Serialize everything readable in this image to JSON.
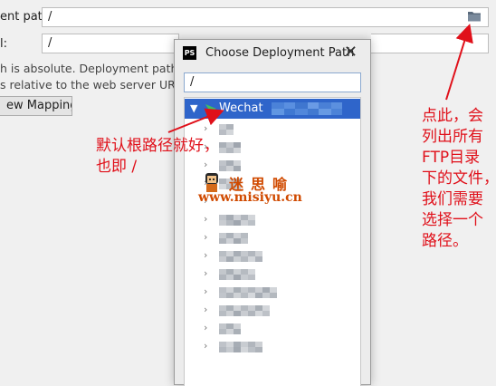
{
  "background_form": {
    "deployment_path_label": "ent path:",
    "deployment_path_value": "/",
    "second_label": "l:",
    "second_value": "/",
    "note_line1": "h is absolute. Deployment path is re",
    "note_line2": "s relative to the web server URL (",
    "mapping_button": "ew Mapping"
  },
  "dialog": {
    "title": "Choose Deployment Path",
    "app_icon_text": "PS",
    "path_value": "/",
    "tree": {
      "root_label": "Wechat",
      "child_count": 12
    }
  },
  "annotations": {
    "left_line1": "默认根路径就好，",
    "left_line2": "也即 /",
    "right_line1": "点此，会",
    "right_line2": "列出所有",
    "right_line3": "FTP目录",
    "right_line4": "下的文件，",
    "right_line5": "我们需要",
    "right_line6": "选择一个",
    "right_line7": "路径。",
    "color": "#e0101a"
  },
  "watermark": {
    "chinese": "迷思喻",
    "url": "www.misiyu.cn"
  },
  "colors": {
    "selection": "#2f65ca",
    "annotation": "#e0101a"
  }
}
